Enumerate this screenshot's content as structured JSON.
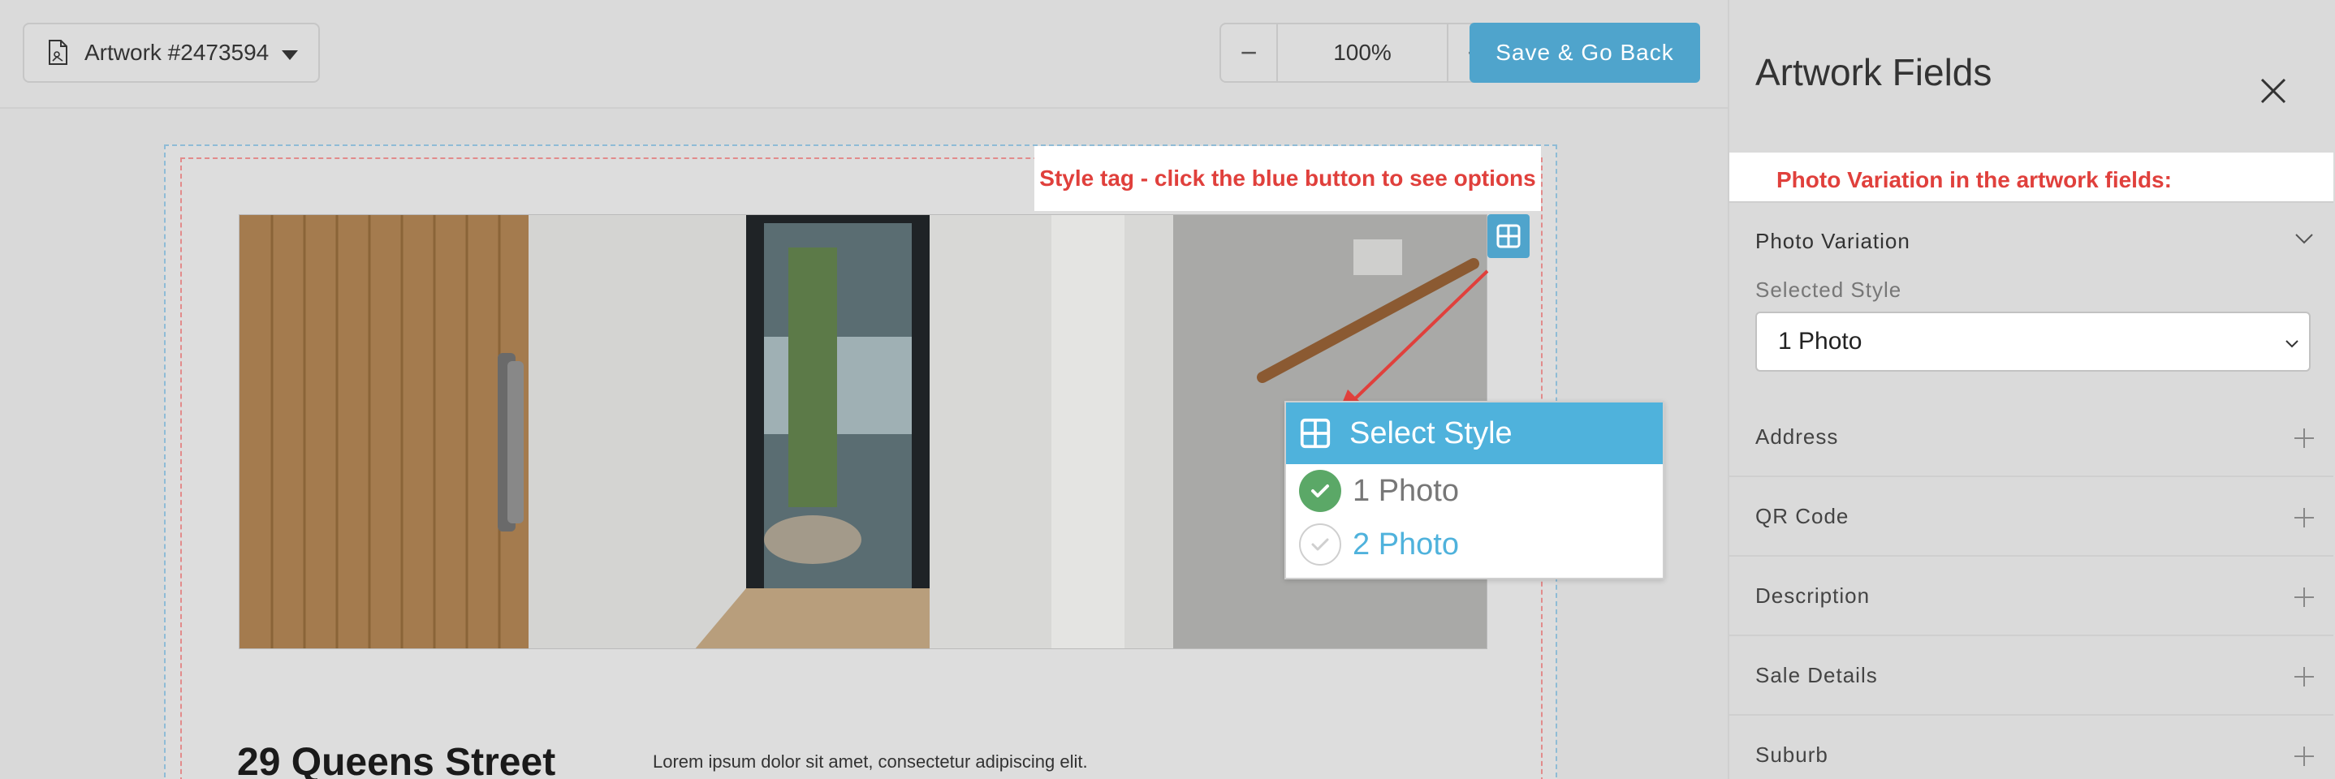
{
  "toolbar": {
    "artwork_name": "Artwork #2473594",
    "zoom_minus": "−",
    "zoom_value": "100%",
    "zoom_plus": "+",
    "save_label": "Save & Go Back"
  },
  "canvas": {
    "style_tag_label": "Style tag - click the blue button to see options",
    "property_title": "29 Queens Street",
    "body_text": "Lorem ipsum dolor sit amet, consectetur adipiscing elit."
  },
  "select_style_popup": {
    "title": "Select Style",
    "options": [
      {
        "label": "1 Photo",
        "selected": true
      },
      {
        "label": "2 Photo",
        "selected": false
      }
    ]
  },
  "side_panel": {
    "title": "Artwork Fields",
    "annotation": "Photo Variation in the artwork fields:",
    "active_section": {
      "label": "Photo Variation",
      "selected_style_label": "Selected Style",
      "selected_style_value": "1 Photo"
    },
    "fields": [
      {
        "label": "Address"
      },
      {
        "label": "QR Code"
      },
      {
        "label": "Description"
      },
      {
        "label": "Sale Details"
      },
      {
        "label": "Suburb"
      }
    ]
  },
  "colors": {
    "accent_blue": "#4fa4cc",
    "popup_blue": "#4fb2dc",
    "annotation_red": "#e0403c",
    "check_green": "#5ba867",
    "option_unselected": "#4fb2dc",
    "option_selected": "#777777"
  },
  "icons": [
    "document-icon",
    "caret-down-icon",
    "grid-icon",
    "check-icon",
    "close-icon",
    "chevron-down-icon",
    "plus-icon"
  ]
}
